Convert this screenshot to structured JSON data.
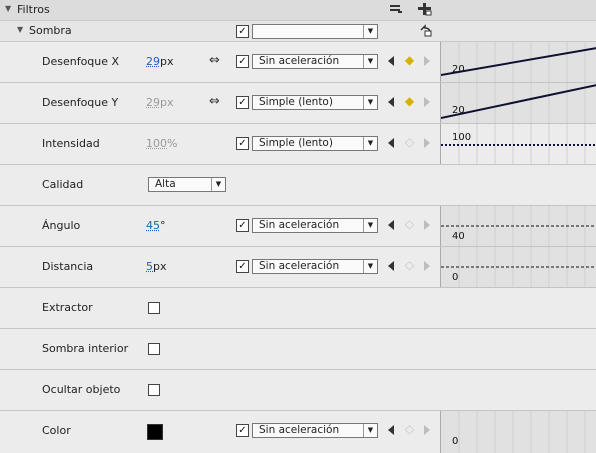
{
  "header": {
    "title": "Filtros",
    "collapse_icon": "triangle-down-icon",
    "remove_icon": "minus-filter-icon",
    "add_icon": "plus-filter-icon"
  },
  "sombra": {
    "title": "Sombra",
    "enabled": true,
    "preset": "",
    "reset_icon": "reset-icon"
  },
  "rows": [
    {
      "name": "Desenfoque X",
      "value": "29",
      "unit": "px",
      "active": true,
      "link_icon": "link-icon",
      "enabled": true,
      "ease": "Sin aceleración",
      "keyframe": "diamond",
      "tl_label": "20"
    },
    {
      "name": "Desenfoque Y",
      "value": "29",
      "unit": "px",
      "active": false,
      "link_icon": "link-icon",
      "enabled": true,
      "ease": "Simple (lento)",
      "keyframe": "diamond",
      "tl_label": "20"
    },
    {
      "name": "Intensidad",
      "value": "100",
      "unit": "%",
      "active": false,
      "enabled": true,
      "ease": "Simple (lento)",
      "keyframe": "empty",
      "tl_label": "100"
    },
    {
      "name": "Calidad",
      "select": "Alta"
    },
    {
      "name": "Ángulo",
      "value": "45",
      "unit": "°",
      "active": true,
      "enabled": true,
      "ease": "Sin aceleración",
      "keyframe": "empty",
      "tl_label": "40"
    },
    {
      "name": "Distancia",
      "value": "5",
      "unit": "px",
      "active": true,
      "enabled": true,
      "ease": "Sin aceleración",
      "keyframe": "empty",
      "tl_label": "0"
    },
    {
      "name": "Extractor",
      "checkbox": false
    },
    {
      "name": "Sombra interior",
      "checkbox": false
    },
    {
      "name": "Ocultar objeto",
      "checkbox": false
    },
    {
      "name": "Color",
      "color": "#000000",
      "enabled": true,
      "ease": "Sin aceleración",
      "keyframe": "empty",
      "tl_label": "0"
    }
  ]
}
